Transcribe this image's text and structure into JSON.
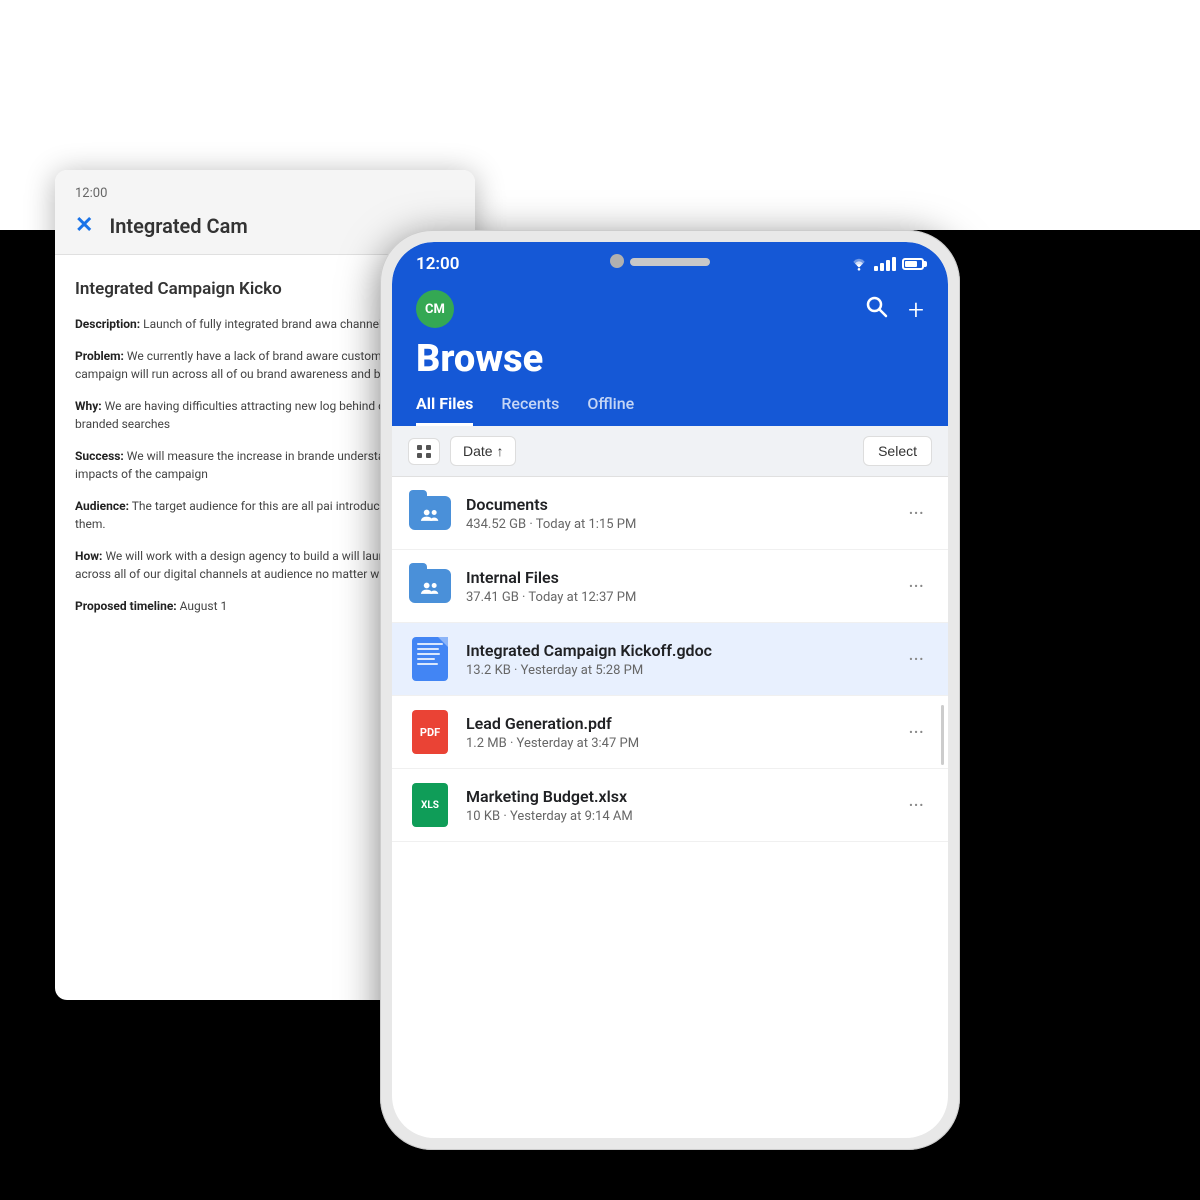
{
  "scene": {
    "back_document": {
      "time": "12:00",
      "title": "Integrated Cam",
      "full_title": "Integrated Campaign Kicko",
      "sections": [
        {
          "label": "Description:",
          "text": "Launch of fully integrated brand awa channels."
        },
        {
          "label": "Problem:",
          "text": "We currently have a lack of brand aware customers. This campaign will run across all of ou brand awareness and brand recall"
        },
        {
          "label": "Why:",
          "text": "We are having difficulties attracting new log behind our non-branded searches"
        },
        {
          "label": "Success:",
          "text": "We will measure the increase in brande understand the full impacts of the campaign"
        },
        {
          "label": "Audience:",
          "text": "The target audience for this are all pai introduce our brand to them."
        },
        {
          "label": "How:",
          "text": "We will work with a design agency to build a will launch this across all of our digital channels at audience no matter where they are"
        },
        {
          "label": "Proposed timeline:",
          "text": "August 1"
        }
      ]
    },
    "phone": {
      "status_bar": {
        "time": "12:00",
        "wifi": "▼",
        "battery_pct": 75
      },
      "app_header": {
        "avatar_initials": "CM",
        "avatar_color": "#34a853",
        "title": "Browse",
        "search_label": "🔍",
        "add_label": "+"
      },
      "tabs": [
        {
          "label": "All Files",
          "active": true
        },
        {
          "label": "Recents",
          "active": false
        },
        {
          "label": "Offline",
          "active": false
        }
      ],
      "toolbar": {
        "grid_icon": "grid",
        "sort_label": "Date ↑",
        "select_label": "Select"
      },
      "files": [
        {
          "type": "folder",
          "name": "Documents",
          "meta": "434.52 GB · Today at 1:15 PM",
          "highlighted": false
        },
        {
          "type": "folder",
          "name": "Internal Files",
          "meta": "37.41 GB · Today at 12:37 PM",
          "highlighted": false
        },
        {
          "type": "gdoc",
          "name": "Integrated Campaign Kickoff.gdoc",
          "meta": "13.2 KB · Yesterday at 5:28 PM",
          "highlighted": true
        },
        {
          "type": "pdf",
          "name": "Lead Generation.pdf",
          "meta": "1.2 MB · Yesterday at 3:47 PM",
          "highlighted": false
        },
        {
          "type": "xlsx",
          "name": "Marketing Budget.xlsx",
          "meta": "10 KB · Yesterday at 9:14 AM",
          "highlighted": false
        }
      ]
    }
  }
}
